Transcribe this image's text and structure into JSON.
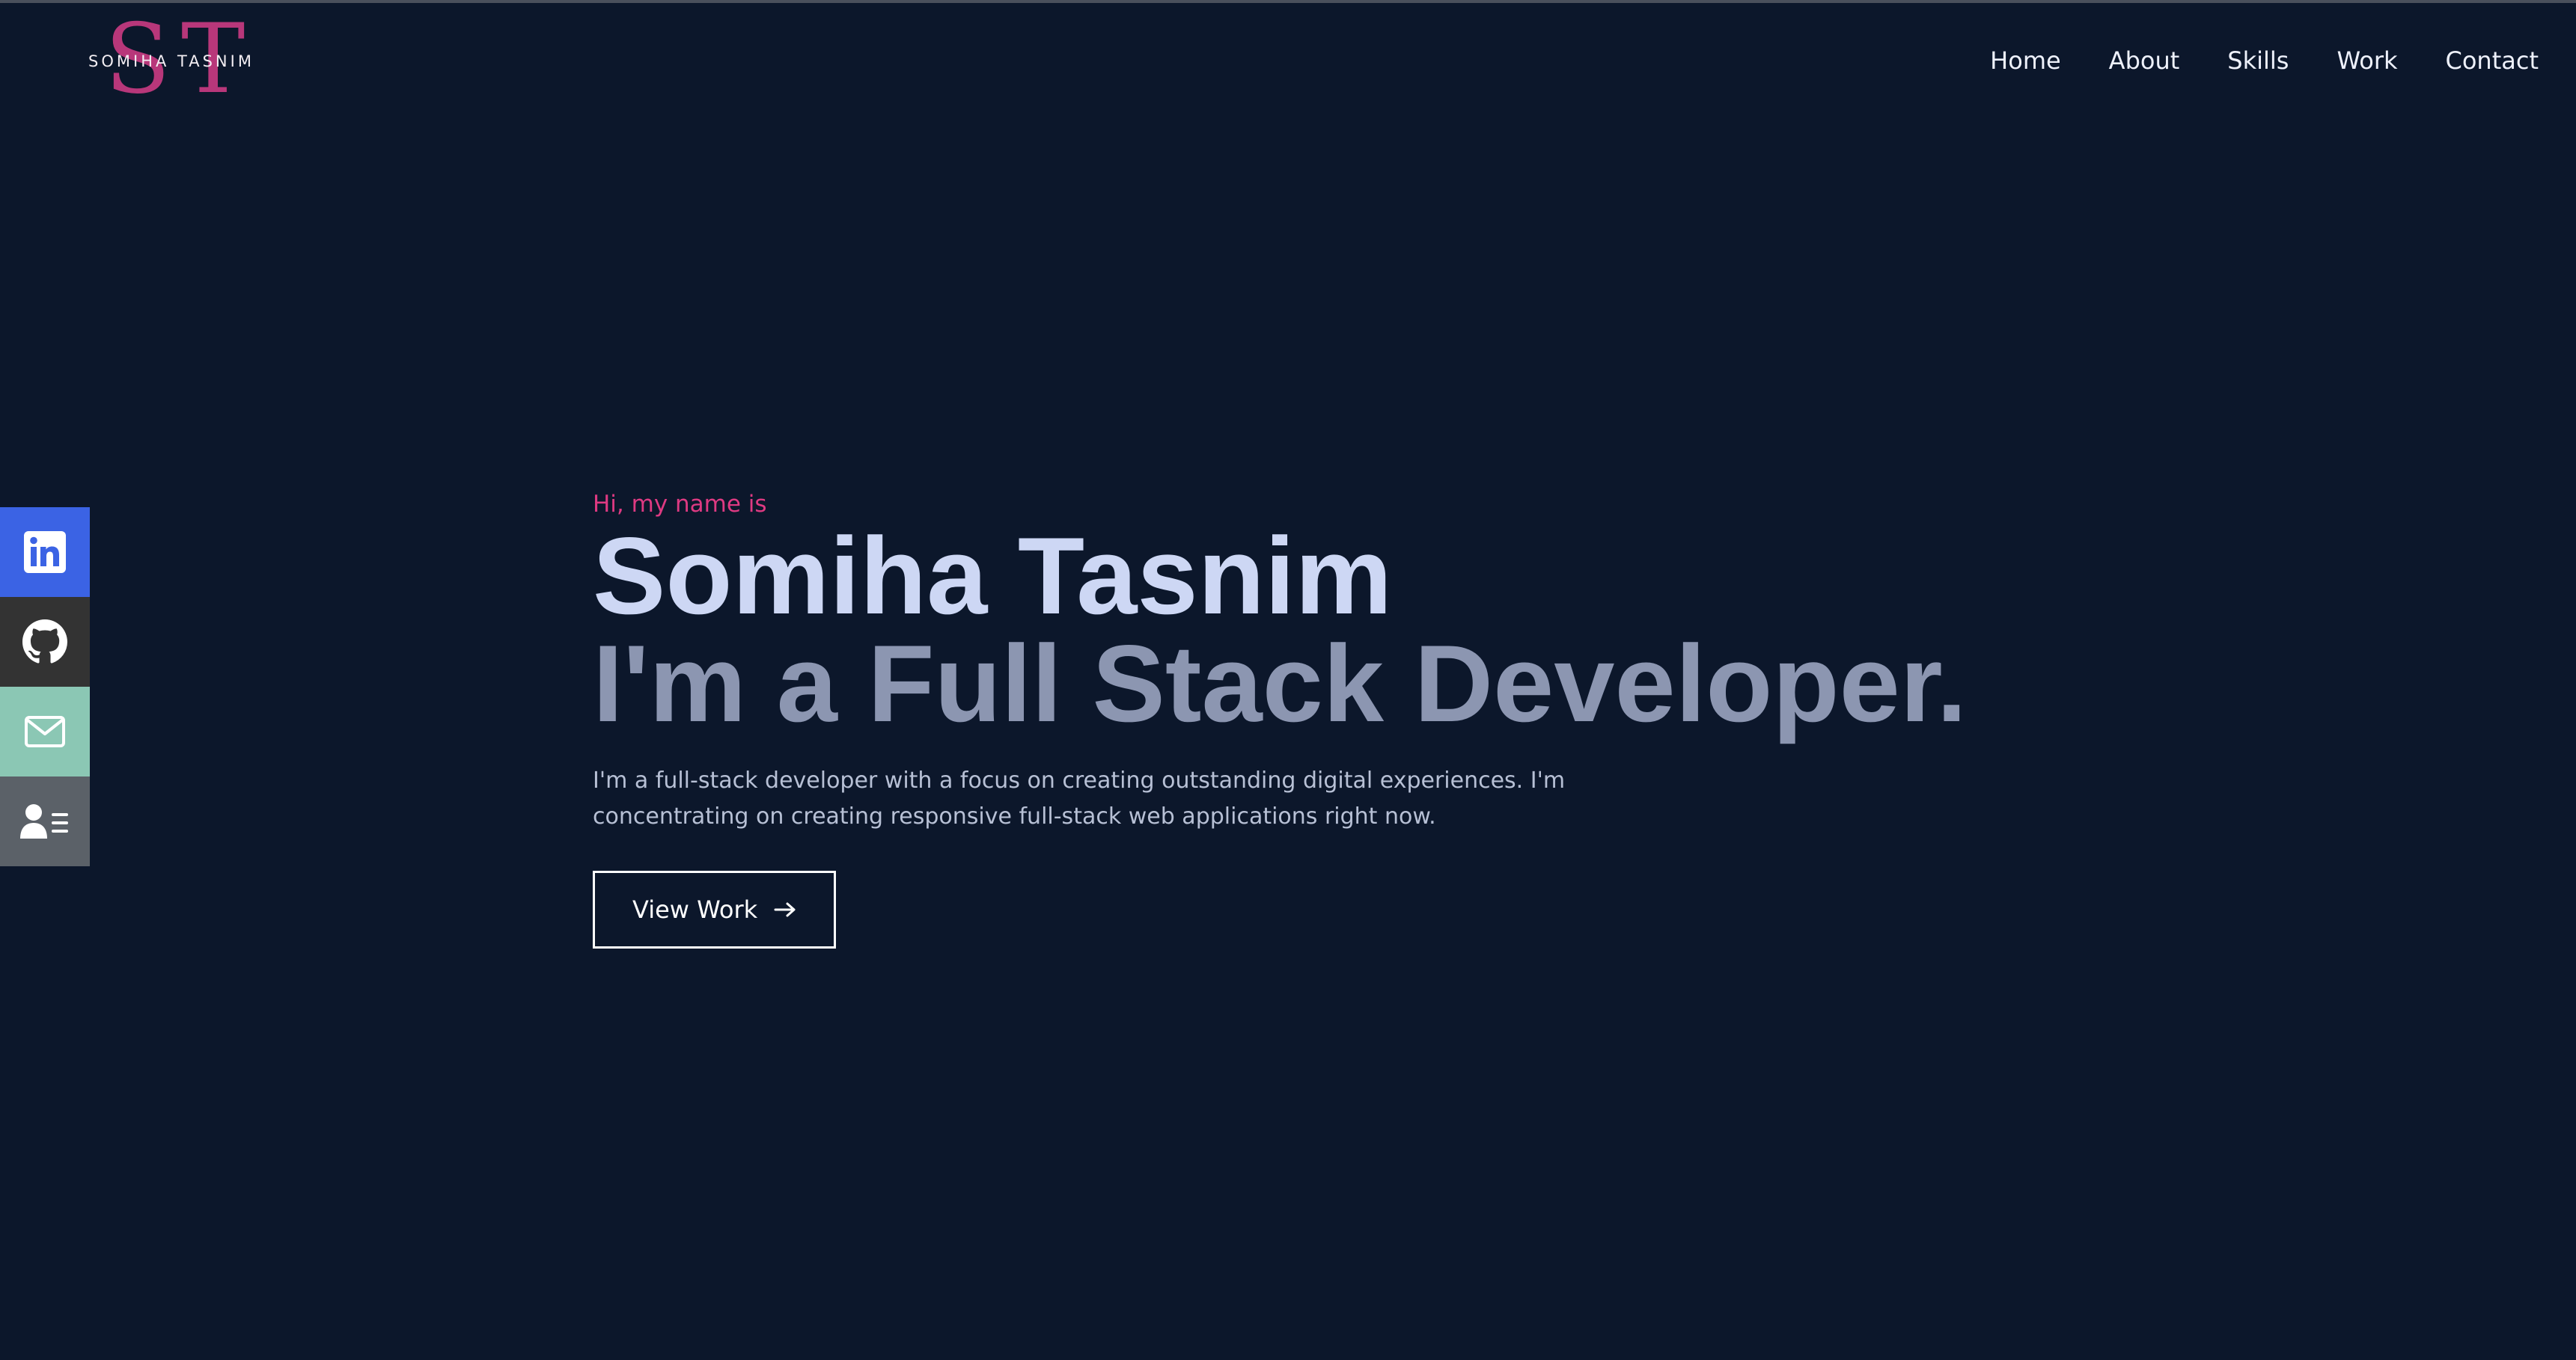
{
  "brand": {
    "monogram_first": "S",
    "monogram_second": "T",
    "name": "SOMIHA TASNIM"
  },
  "nav": {
    "items": [
      "Home",
      "About",
      "Skills",
      "Work",
      "Contact"
    ]
  },
  "social": {
    "items": [
      {
        "icon": "linkedin-icon",
        "color": "#3b63e4"
      },
      {
        "icon": "github-icon",
        "color": "#333333"
      },
      {
        "icon": "mail-icon",
        "color": "#8bc7b4"
      },
      {
        "icon": "resume-icon",
        "color": "#5b6168"
      }
    ]
  },
  "hero": {
    "greeting": "Hi, my name is",
    "name": "Somiha Tasnim",
    "role": "I'm a Full Stack Developer.",
    "description": "I'm a full-stack developer with a focus on creating outstanding digital experiences. I'm concentrating on creating responsive full-stack web applications right now.",
    "cta_label": "View Work",
    "cta_icon": "arrow-right-icon"
  },
  "colors": {
    "background": "#0c172b",
    "accent": "#de3a82",
    "logo": "#b8377a",
    "name": "#cdd7f4",
    "role": "#8c96b1"
  }
}
